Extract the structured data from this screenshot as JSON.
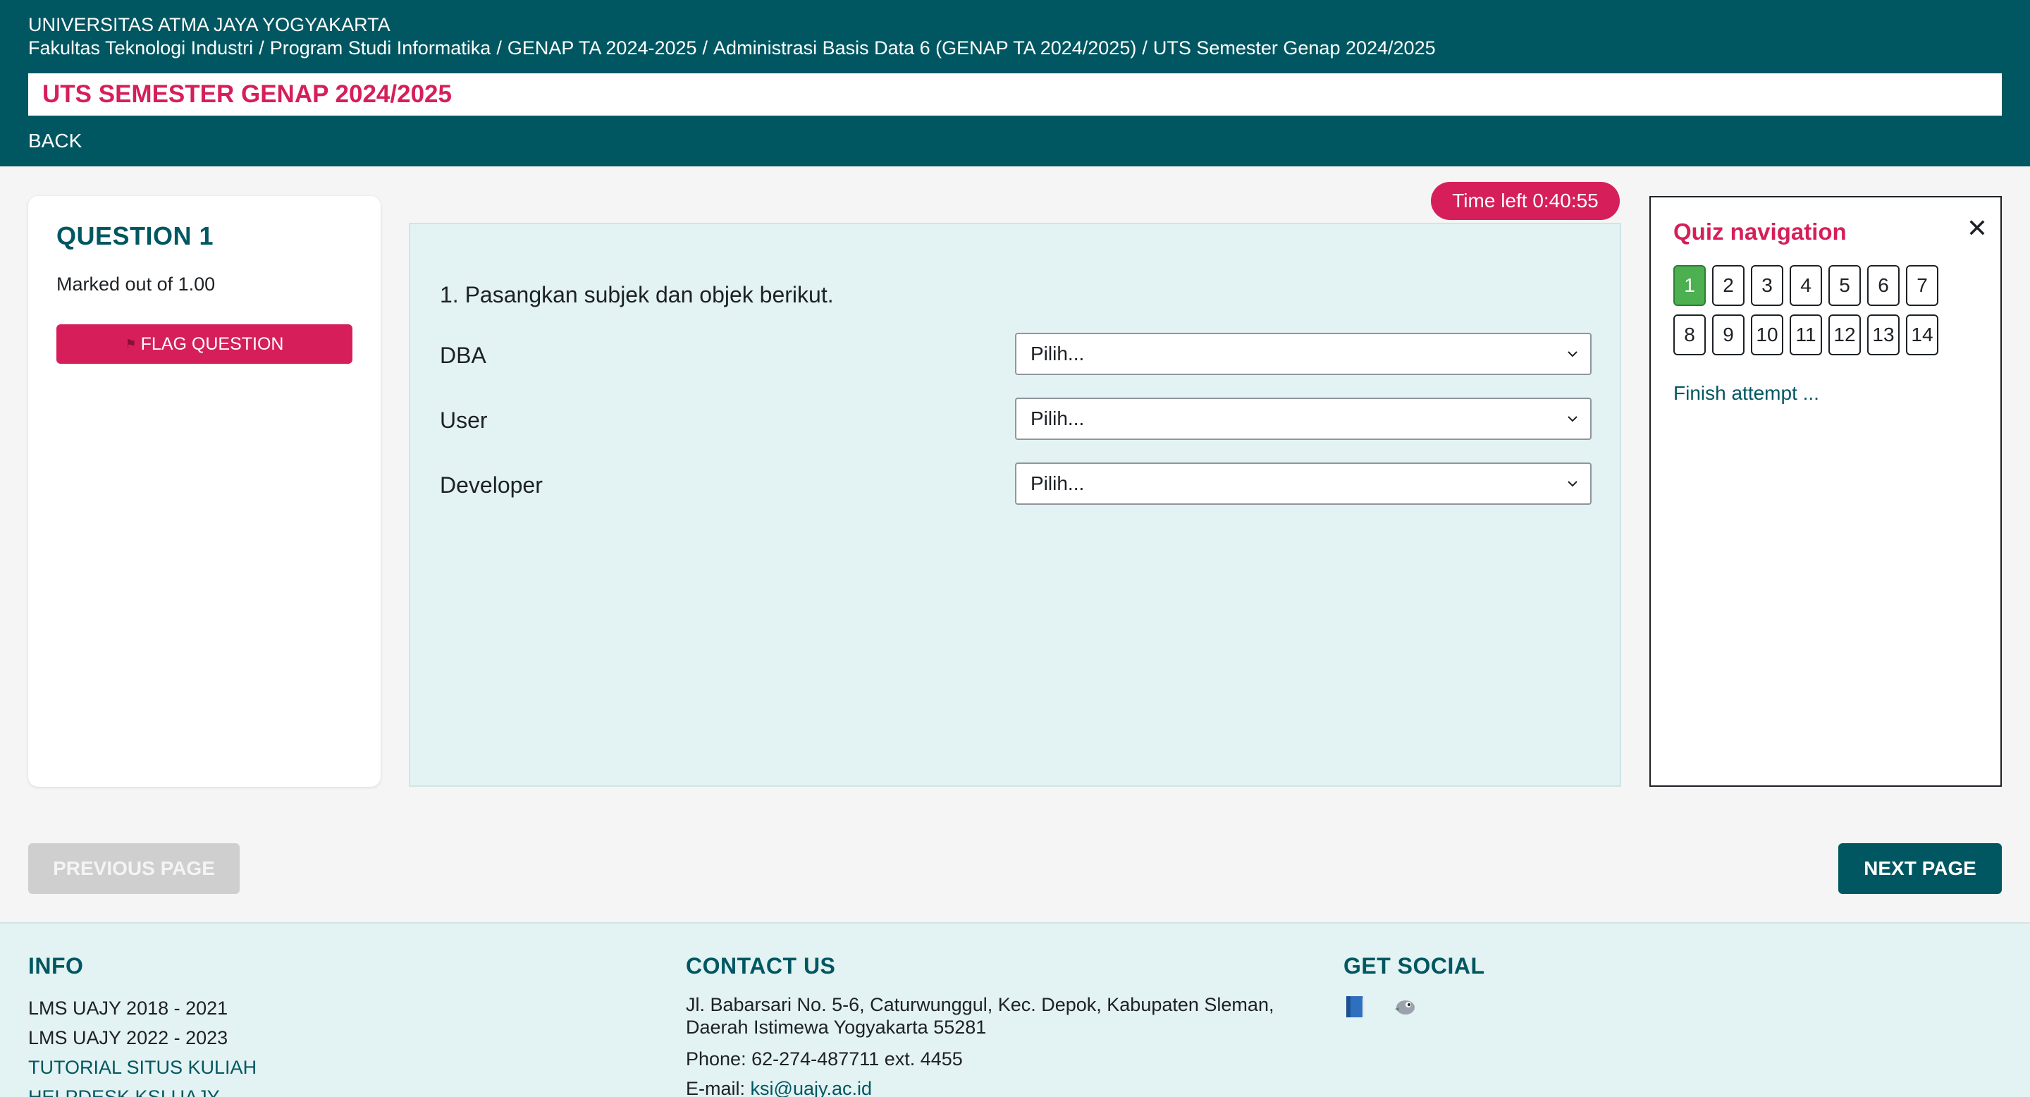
{
  "header": {
    "university": "UNIVERSITAS ATMA JAYA YOGYAKARTA",
    "breadcrumb": [
      "Fakultas Teknologi Industri",
      "Program Studi Informatika",
      "GENAP TA 2024-2025",
      "Administrasi Basis Data 6 (GENAP TA 2024/2025)",
      "UTS Semester Genap 2024/2025"
    ],
    "breadcrumb_separator": "/",
    "page_title": "UTS SEMESTER GENAP 2024/2025",
    "back_label": "BACK"
  },
  "question_info": {
    "title": "QUESTION 1",
    "marked": "Marked out of 1.00",
    "flag_label": "FLAG QUESTION"
  },
  "timer": {
    "label": "Time left 0:40:55"
  },
  "question": {
    "text": "1. Pasangkan subjek dan objek berikut.",
    "rows": [
      {
        "label": "DBA",
        "selected": "Pilih..."
      },
      {
        "label": "User",
        "selected": "Pilih..."
      },
      {
        "label": "Developer",
        "selected": "Pilih..."
      }
    ]
  },
  "quiz_navigation": {
    "title": "Quiz navigation",
    "close_icon": "close-icon",
    "questions": [
      "1",
      "2",
      "3",
      "4",
      "5",
      "6",
      "7",
      "8",
      "9",
      "10",
      "11",
      "12",
      "13",
      "14"
    ],
    "current": "1",
    "finish_label": "Finish attempt ..."
  },
  "page_nav": {
    "previous_label": "PREVIOUS PAGE",
    "next_label": "NEXT PAGE"
  },
  "footer": {
    "info": {
      "title": "INFO",
      "lines": [
        "LMS UAJY 2018 - 2021",
        "LMS UAJY 2022 - 2023"
      ],
      "links": [
        "TUTORIAL SITUS KULIAH",
        "HELPDESK KSI UAJY"
      ]
    },
    "contact": {
      "title": "CONTACT US",
      "address": "Jl. Babarsari No. 5-6, Caturwunggul, Kec. Depok, Kabupaten Sleman, Daerah Istimewa Yogyakarta 55281",
      "phone": "Phone: 62-274-487711 ext. 4455",
      "email_label": "E-mail:",
      "email": "ksi@uajy.ac.id"
    },
    "social": {
      "title": "GET SOCIAL",
      "icons": [
        "book-icon",
        "bird-icon"
      ]
    }
  },
  "colors": {
    "brand": "#005761",
    "accent": "#d61f5a",
    "current_question": "#4caf50",
    "panel_bg": "#e3f2f2"
  }
}
